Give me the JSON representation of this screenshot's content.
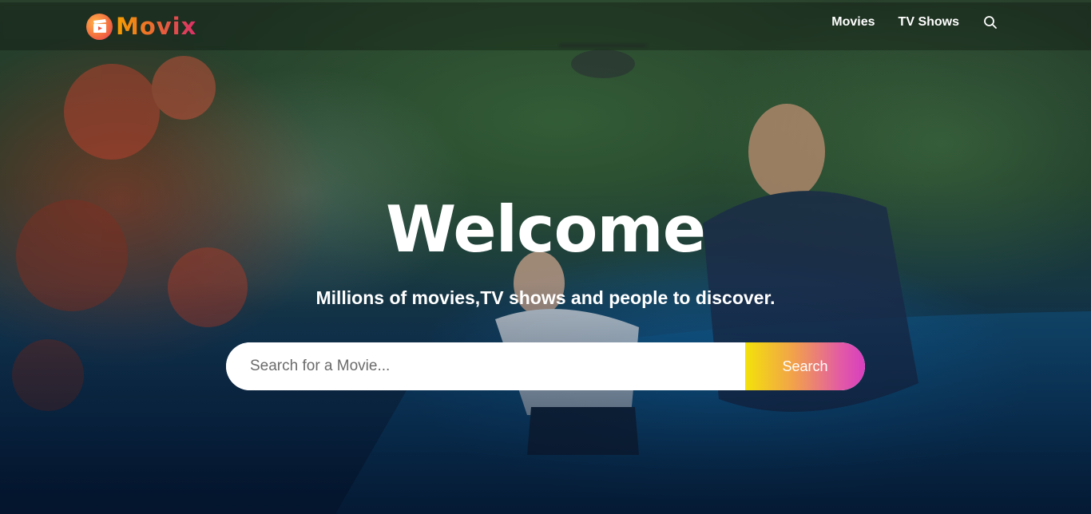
{
  "header": {
    "logo_text": "Movix",
    "nav": {
      "movies": "Movies",
      "tv_shows": "TV Shows"
    },
    "search_icon": "search-icon"
  },
  "hero": {
    "title": "Welcome",
    "subtitle": "Millions of movies,TV shows and people to discover.",
    "search": {
      "placeholder": "Search for a Movie...",
      "button_label": "Search"
    }
  },
  "colors": {
    "background": "#04152d",
    "logo_gradient_start": "#f89e00",
    "logo_gradient_end": "#da2f68",
    "button_gradient_start": "#f3e20a",
    "button_gradient_end": "#d83ec0"
  }
}
